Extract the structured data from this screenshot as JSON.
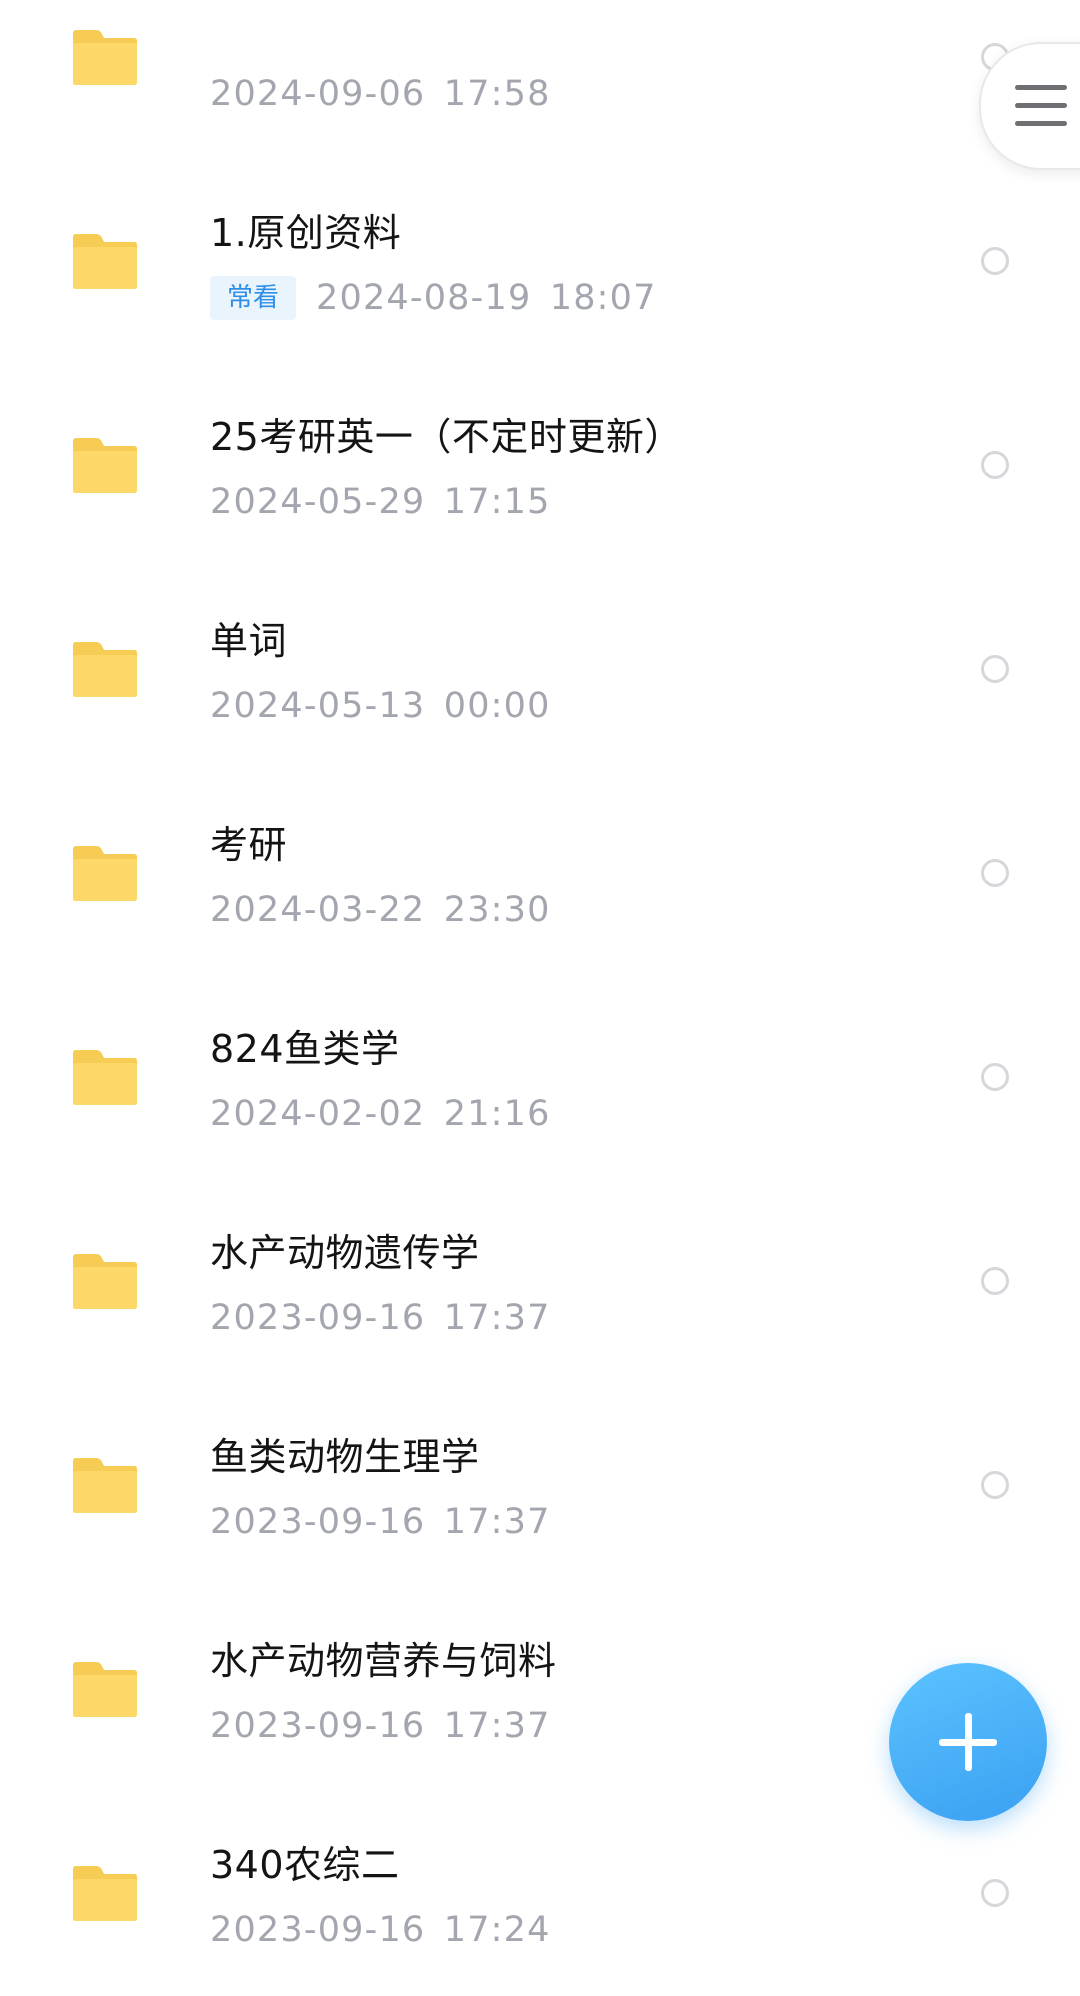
{
  "files": [
    {
      "name": "",
      "date": "2024-09-06  17:58",
      "badge": ""
    },
    {
      "name": "1.原创资料",
      "date": "2024-08-19  18:07",
      "badge": "常看"
    },
    {
      "name": "25考研英一（不定时更新）",
      "date": "2024-05-29  17:15",
      "badge": ""
    },
    {
      "name": "单词",
      "date": "2024-05-13  00:00",
      "badge": ""
    },
    {
      "name": "考研",
      "date": "2024-03-22  23:30",
      "badge": ""
    },
    {
      "name": "824鱼类学",
      "date": "2024-02-02  21:16",
      "badge": ""
    },
    {
      "name": "水产动物遗传学",
      "date": "2023-09-16  17:37",
      "badge": ""
    },
    {
      "name": "鱼类动物生理学",
      "date": "2023-09-16  17:37",
      "badge": ""
    },
    {
      "name": "水产动物营养与饲料",
      "date": "2023-09-16  17:37",
      "badge": ""
    },
    {
      "name": "340农综二",
      "date": "2023-09-16  17:24",
      "badge": ""
    }
  ],
  "icons": {
    "folder": "folder-icon",
    "menu": "menu-icon",
    "add": "plus-icon",
    "select": "radio-circle"
  },
  "colors": {
    "folder": "#fcd869",
    "folder_tab": "#f6cc55",
    "badge_text": "#2f8fe8",
    "badge_bg": "#eaf4fd",
    "date_text": "#a3a6ae",
    "fab": "#42a8f5"
  }
}
